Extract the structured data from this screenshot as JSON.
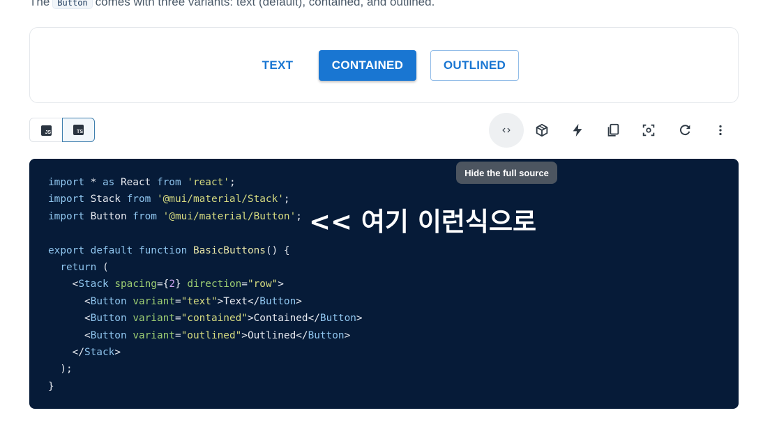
{
  "intro": {
    "prefix": "The",
    "code": "Button",
    "suffix": "comes with three variants: text (default), contained, and outlined."
  },
  "demo": {
    "buttons": {
      "text": "TEXT",
      "contained": "CONTAINED",
      "outlined": "OUTLINED"
    }
  },
  "toolbar": {
    "js_label": "JS",
    "ts_label": "TS",
    "tooltip": "Hide the full source",
    "icons": [
      "code-icon",
      "sandbox-icon",
      "stackblitz-icon",
      "copy-icon",
      "focus-icon",
      "reset-icon",
      "more-icon"
    ]
  },
  "code": {
    "l1": {
      "a": "import",
      "b": " * ",
      "c": "as",
      "d": " React ",
      "e": "from",
      "f": " ",
      "g": "'react'",
      "h": ";"
    },
    "l2": {
      "a": "import",
      "b": " Stack ",
      "c": "from",
      "d": " ",
      "e": "'@mui/material/Stack'",
      "f": ";"
    },
    "l3": {
      "a": "import",
      "b": " Button ",
      "c": "from",
      "d": " ",
      "e": "'@mui/material/Button'",
      "f": ";"
    },
    "l5": {
      "a": "export",
      "b": " ",
      "c": "default",
      "d": " ",
      "e": "function",
      "f": " ",
      "g": "BasicButtons",
      "h": "() {"
    },
    "l6": {
      "a": "  ",
      "b": "return",
      "c": " ("
    },
    "l7": {
      "a": "    <",
      "b": "Stack",
      "c": " ",
      "d": "spacing",
      "e": "={",
      "f": "2",
      "g": "} ",
      "h": "direction",
      "i": "=",
      "j": "\"row\"",
      "k": ">"
    },
    "l8": {
      "a": "      <",
      "b": "Button",
      "c": " ",
      "d": "variant",
      "e": "=",
      "f": "\"text\"",
      "g": ">Text</",
      "h": "Button",
      "i": ">"
    },
    "l9": {
      "a": "      <",
      "b": "Button",
      "c": " ",
      "d": "variant",
      "e": "=",
      "f": "\"contained\"",
      "g": ">Contained</",
      "h": "Button",
      "i": ">"
    },
    "l10": {
      "a": "      <",
      "b": "Button",
      "c": " ",
      "d": "variant",
      "e": "=",
      "f": "\"outlined\"",
      "g": ">Outlined</",
      "h": "Button",
      "i": ">"
    },
    "l11": {
      "a": "    </",
      "b": "Stack",
      "c": ">"
    },
    "l12": {
      "a": "  );"
    },
    "l13": {
      "a": "}"
    }
  },
  "annotation": "<< 여기 이런식으로",
  "colors": {
    "primary": "#1976d2",
    "code_bg": "#061b38",
    "tooltip_bg": "#4c5560"
  }
}
